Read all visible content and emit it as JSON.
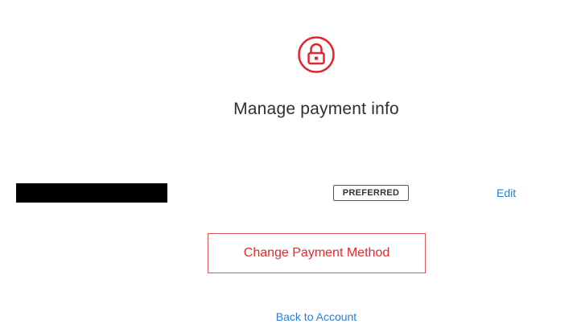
{
  "header": {
    "icon": "lock-icon",
    "title": "Manage payment info",
    "accent_color": "#e0262e"
  },
  "payment_method": {
    "masked_value": "",
    "badge_label": "PREFERRED",
    "edit_label": "Edit"
  },
  "actions": {
    "change_label": "Change Payment Method",
    "back_label": "Back to Account"
  },
  "colors": {
    "link": "#2a7fd4",
    "button_text": "#e02b2b",
    "button_border": "#e05a5a"
  }
}
